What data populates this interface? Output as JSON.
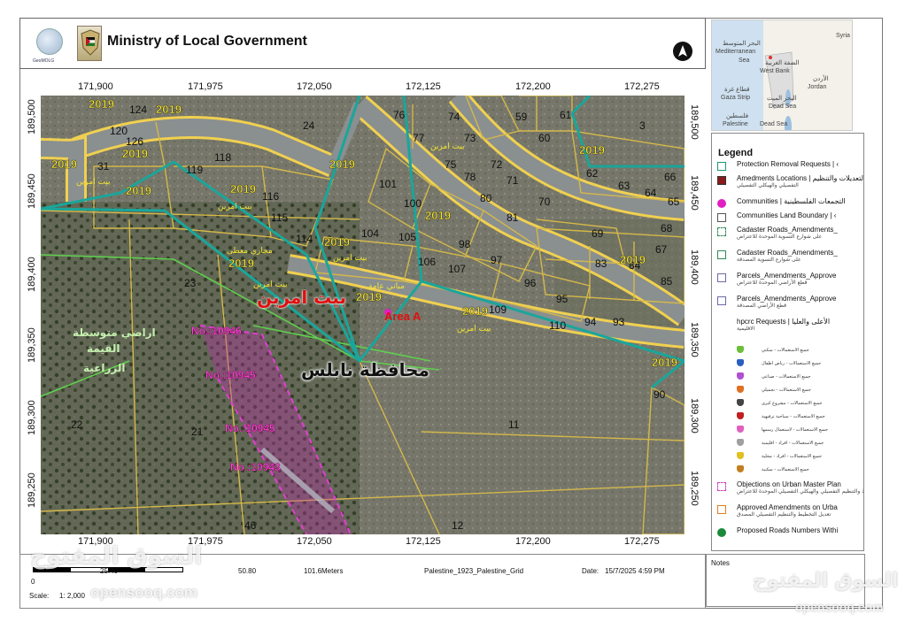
{
  "header": {
    "title": "Ministry of Local Government",
    "logo_caption": "GeoMOLG"
  },
  "grid": {
    "x_ticks": [
      "171,900",
      "171,975",
      "172,050",
      "172,125",
      "172,200",
      "172,275"
    ],
    "x_ticks_bottom": [
      "171,900",
      "171,975",
      "172,050",
      "172,125",
      "172,200",
      "172,275"
    ],
    "y_ticks": [
      "189,500",
      "189,450",
      "189,400",
      "189,350",
      "189,300",
      "189,250"
    ]
  },
  "inset_map": {
    "labels": {
      "syria": "Syria",
      "med_ar": "البحر المتوسط",
      "med": "Mediterranean",
      "sea": "Sea",
      "wb_ar": "الضفة الغربية",
      "wb": "West Bank",
      "jordan_ar": "الأردن",
      "jordan": "Jordan",
      "gaza_ar": "قطاع غزة",
      "gaza": "Gaza Strip",
      "dead_ar": "البحر الميت",
      "dead": "Dead Sea",
      "pal_ar": "فلسطين",
      "pal": "Palestine",
      "dead2": "Dead Sea"
    },
    "colors": {
      "sea": "#cfe1f0",
      "land": "#f3f1ea",
      "westbank": "#e0e0e0"
    }
  },
  "legend": {
    "title": "Legend",
    "items": [
      {
        "label": "Protection Removal Requests | ‹",
        "sub": "",
        "color": "#1a9a6a",
        "shape": "box"
      },
      {
        "label": "Amedments Locations | التعديلات والتنظيم",
        "sub": "التفصيلي والهيكلي التفصيلي",
        "color": "#8b1a1a",
        "shape": "fill"
      },
      {
        "label": "Communities | التجمعات الفلسطينية",
        "sub": "",
        "color": "#e020c0",
        "shape": "dot"
      },
      {
        "label": "Communities Land Boundary | ‹",
        "sub": "",
        "color": "#555555",
        "shape": "box"
      },
      {
        "label": "Cadaster Roads_Amendments_",
        "sub": "على شوارع التسوية الموحدة للاعتراض",
        "color": "#2e8b57",
        "shape": "dash"
      },
      {
        "label": "Cadaster Roads_Amendments_",
        "sub": "على شوارع التسوية المصدقة",
        "color": "#2e8b57",
        "shape": "box"
      },
      {
        "label": "Parcels_Amendments_Approve",
        "sub": "قطع الأراضي الموحدة للاعتراض",
        "color": "#6a6aa8",
        "shape": "box"
      },
      {
        "label": "Parcels_Amendments_Approve",
        "sub": "قطع الأراضي المصدقة",
        "color": "#6a6aa8",
        "shape": "box"
      },
      {
        "label": "hpcrc Requests | الأعلى والعليا",
        "sub": "الاقليمية",
        "color": "#ffffff",
        "shape": "none"
      }
    ],
    "hpcrc_subitems": [
      {
        "label": "جميع الاستعمالات - سكني",
        "color": "#6bbf3a"
      },
      {
        "label": "جميع الاستعمالات - رياض اطفال",
        "color": "#2a5fc0"
      },
      {
        "label": "جميع الاستعمالات - صناعي",
        "color": "#b050d0"
      },
      {
        "label": "جميع الاستعمالات - تجميلي",
        "color": "#e07020"
      },
      {
        "label": "جميع الاستعمالات - مشروع كبرى",
        "color": "#444444"
      },
      {
        "label": "جميع الاستعمالات - سياحية ترفيهية",
        "color": "#c02020"
      },
      {
        "label": "جميع الاستعمالات - لاستعمال رسمها",
        "color": "#e060c0"
      },
      {
        "label": "جميع الاستعمالات - افراد - اقليمية",
        "color": "#a0a0a0"
      },
      {
        "label": "جميع الاستعمالات - افراد - محلية",
        "color": "#e0c020"
      },
      {
        "label": "جميع الاستعمالات - سكنية",
        "color": "#c08020"
      }
    ],
    "tail_items": [
      {
        "label": "Objections on Urban Master Plan",
        "sub": "تخطيط والتنظيم التفصيلي والهيكلي التفصيلي الموحدة للاعتراض",
        "color": "#d040c0",
        "shape": "dash"
      },
      {
        "label": "Approved Amendments on Urba",
        "sub": "تعديل التخطيط والتنظيم التفصيلي المصدق",
        "color": "#e08020",
        "shape": "box"
      },
      {
        "label": "Proposed Roads Numbers Withi",
        "sub": "",
        "color": "#1a8a3a",
        "shape": "dot"
      }
    ]
  },
  "footer": {
    "scale_numbers": [
      "0",
      "25.40",
      "50.80",
      "101.6Meters"
    ],
    "scale_label": "Scale:",
    "scale_value": "1: 2,000",
    "projection": "Palestine_1923_Palestine_Grid",
    "date_label": "Date:",
    "date_value": "15/7/2025 4:59 PM"
  },
  "notes": {
    "label": "Notes"
  },
  "map_labels": {
    "year": "2019",
    "town": "بيت امرين",
    "governorate": "محافظة نابلس",
    "area_a": "Area A",
    "agri_1": "اراضي متوسطة",
    "agri_2": "القيمة",
    "agri_3": "الزراعية",
    "nabatat": "مباني عامة",
    "mahaji": "مجاري معطى",
    "hawd": "حوض",
    "ref_10946": "No.:10946",
    "ref_10945": "No.:10945",
    "ref_10945b": "No.:10945",
    "ref_10943": "No.:10943",
    "parcels": [
      "76",
      "74",
      "77",
      "73",
      "75",
      "59",
      "3",
      "124",
      "119",
      "118",
      "126",
      "101",
      "100",
      "104",
      "105",
      "106",
      "107",
      "98",
      "97",
      "96",
      "95",
      "94",
      "93",
      "109",
      "110",
      "114",
      "115",
      "116",
      "62",
      "63",
      "64",
      "65",
      "69",
      "83",
      "84",
      "85",
      "67",
      "23",
      "22",
      "21",
      "11",
      "12",
      "46",
      "90",
      "70",
      "72",
      "78",
      "80",
      "81",
      "71",
      "61",
      "60",
      "24",
      "120",
      "31",
      "66",
      "68"
    ]
  },
  "watermarks": {
    "ar": "السوق المفتوح",
    "en": "opensooq.com"
  },
  "colors": {
    "road_outline": "#f0d050",
    "parcel_line": "#d4b84a",
    "boundary_teal": "#1aa69b",
    "green_line": "#5fcf4f",
    "magenta": "#e040d0",
    "town_red": "#e01010",
    "label_yellow": "#f5e532"
  }
}
